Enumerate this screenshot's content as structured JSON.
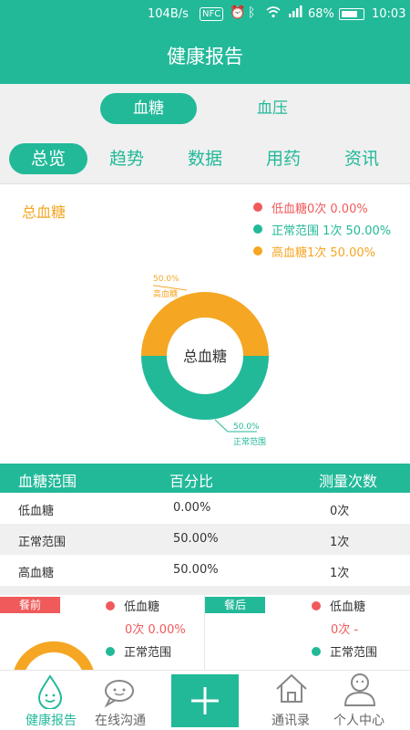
{
  "status_bar": {
    "speed": "104B/s",
    "nfc": "NFC",
    "battery": "68%",
    "time": "10:03"
  },
  "header": {
    "title": "健康报告"
  },
  "type_switch": {
    "active": "血糖",
    "inactive": "血压"
  },
  "tabs": [
    "总览",
    "趋势",
    "数据",
    "用药",
    "资讯"
  ],
  "summary": {
    "title": "总血糖",
    "legend": [
      {
        "label": "低血糖0次 0.00%",
        "color": "#f05a5a"
      },
      {
        "label": "正常范围 1次 50.00%",
        "color": "#22b999"
      },
      {
        "label": "高血糖1次 50.00%",
        "color": "#f5a623"
      }
    ],
    "donut": {
      "center_label": "总血糖",
      "top_pct": "50.0%",
      "top_name": "高血糖",
      "bottom_pct": "50.0%",
      "bottom_name": "正常范围"
    }
  },
  "chart_data": {
    "type": "pie",
    "title": "总血糖",
    "categories": [
      "低血糖",
      "正常范围",
      "高血糖"
    ],
    "values": [
      0,
      50,
      50
    ],
    "colors": [
      "#f05a5a",
      "#22b999",
      "#f5a623"
    ]
  },
  "table": {
    "headers": [
      "血糖范围",
      "百分比",
      "测量次数"
    ],
    "rows": [
      [
        "低血糖",
        "0.00%",
        "0次"
      ],
      [
        "正常范围",
        "50.00%",
        "1次"
      ],
      [
        "高血糖",
        "50.00%",
        "1次"
      ]
    ]
  },
  "meals": {
    "before": {
      "tag": "餐前",
      "tag_color": "#f05a5a",
      "low_label": "低血糖",
      "low_value": "0次 0.00%",
      "normal_label": "正常范围"
    },
    "after": {
      "tag": "餐后",
      "tag_color": "#22b999",
      "low_label": "低血糖",
      "low_value": "0次 -",
      "normal_label": "正常范围"
    }
  },
  "bottom_nav": {
    "items": [
      "健康报告",
      "在线沟通",
      "通讯录",
      "个人中心"
    ],
    "add_icon": "plus-icon"
  },
  "colors": {
    "accent": "#22b999",
    "orange": "#f5a623",
    "red": "#f05a5a"
  }
}
